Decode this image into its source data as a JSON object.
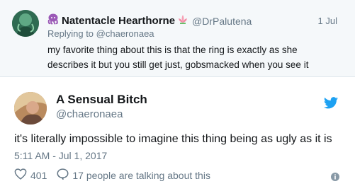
{
  "reply": {
    "name": "Natentacle Hearthorne",
    "handle": "@DrPalutena",
    "date": "1 Jul",
    "replying_prefix": "Replying to",
    "replying_to": "@chaeronaea",
    "text": "my favorite thing about this is that the ring is exactly as she describes it but you still get just, gobsmacked when you see it",
    "name_emojis": [
      "octopus-icon",
      "lotus-flower-icon"
    ]
  },
  "tweet": {
    "name": "A Sensual Bitch",
    "handle": "@chaeronaea",
    "text": "it's literally impossible to imagine this thing being as ugly as it is",
    "timestamp": "5:11 AM - Jul 1, 2017",
    "likes": "401",
    "talking": "17 people are talking about this"
  },
  "colors": {
    "accent": "#1da1f2",
    "secondary_text": "#657786",
    "reply_background": "#f5f8fa"
  }
}
